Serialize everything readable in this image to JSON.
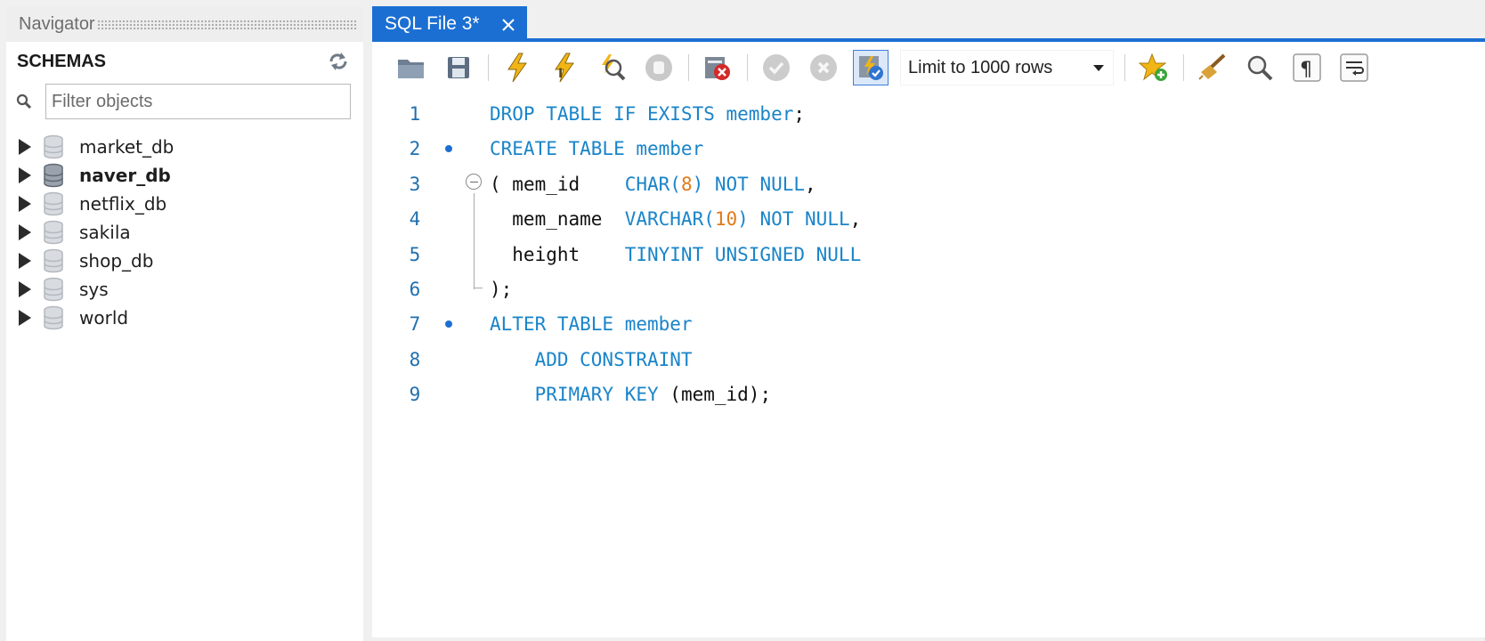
{
  "navigator": {
    "title": "Navigator",
    "schemas_label": "SCHEMAS",
    "filter_placeholder": "Filter objects",
    "schemas": [
      {
        "name": "market_db",
        "active": false
      },
      {
        "name": "naver_db",
        "active": true
      },
      {
        "name": "netflix_db",
        "active": false
      },
      {
        "name": "sakila",
        "active": false
      },
      {
        "name": "shop_db",
        "active": false
      },
      {
        "name": "sys",
        "active": false
      },
      {
        "name": "world",
        "active": false
      }
    ]
  },
  "editor": {
    "tab_label": "SQL File 3*",
    "toolbar": {
      "limit_label": "Limit to 1000 rows",
      "buttons": [
        "open-file-icon",
        "save-icon",
        "execute-icon",
        "execute-current-icon",
        "explain-icon",
        "stop-icon",
        "toggle-error-icon",
        "commit-icon",
        "rollback-icon",
        "autocommit-icon",
        "add-snippet-icon",
        "beautify-icon",
        "find-icon",
        "invisible-chars-icon",
        "wrap-lines-icon"
      ]
    },
    "lines": [
      {
        "num": "1",
        "dot": false,
        "tokens": [
          [
            "DROP TABLE IF EXISTS member",
            "kw"
          ],
          [
            ";",
            "plain"
          ]
        ]
      },
      {
        "num": "2",
        "dot": true,
        "tokens": [
          [
            "CREATE TABLE member",
            "kw"
          ]
        ]
      },
      {
        "num": "3",
        "dot": false,
        "tokens": [
          [
            "( ",
            "plain"
          ],
          [
            "mem_id    ",
            "plain"
          ],
          [
            "CHAR(",
            "kw"
          ],
          [
            "8",
            "num"
          ],
          [
            ") NOT NULL",
            "kw"
          ],
          [
            ",",
            "plain"
          ]
        ]
      },
      {
        "num": "4",
        "dot": false,
        "tokens": [
          [
            "  mem_name  ",
            "plain"
          ],
          [
            "VARCHAR(",
            "kw"
          ],
          [
            "10",
            "num"
          ],
          [
            ") NOT NULL",
            "kw"
          ],
          [
            ",",
            "plain"
          ]
        ]
      },
      {
        "num": "5",
        "dot": false,
        "tokens": [
          [
            "  height    ",
            "plain"
          ],
          [
            "TINYINT UNSIGNED NULL",
            "kw"
          ]
        ]
      },
      {
        "num": "6",
        "dot": false,
        "tokens": [
          [
            ");",
            "plain"
          ]
        ]
      },
      {
        "num": "7",
        "dot": true,
        "tokens": [
          [
            "ALTER TABLE member",
            "kw"
          ]
        ]
      },
      {
        "num": "8",
        "dot": false,
        "tokens": [
          [
            "    ADD CONSTRAINT",
            "kw"
          ]
        ]
      },
      {
        "num": "9",
        "dot": false,
        "tokens": [
          [
            "    PRIMARY KEY ",
            "kw"
          ],
          [
            "(mem_id);",
            "plain"
          ]
        ]
      }
    ]
  },
  "colors": {
    "accent": "#1c6fd2",
    "keyword": "#1a84c9",
    "number": "#e07a1a"
  }
}
